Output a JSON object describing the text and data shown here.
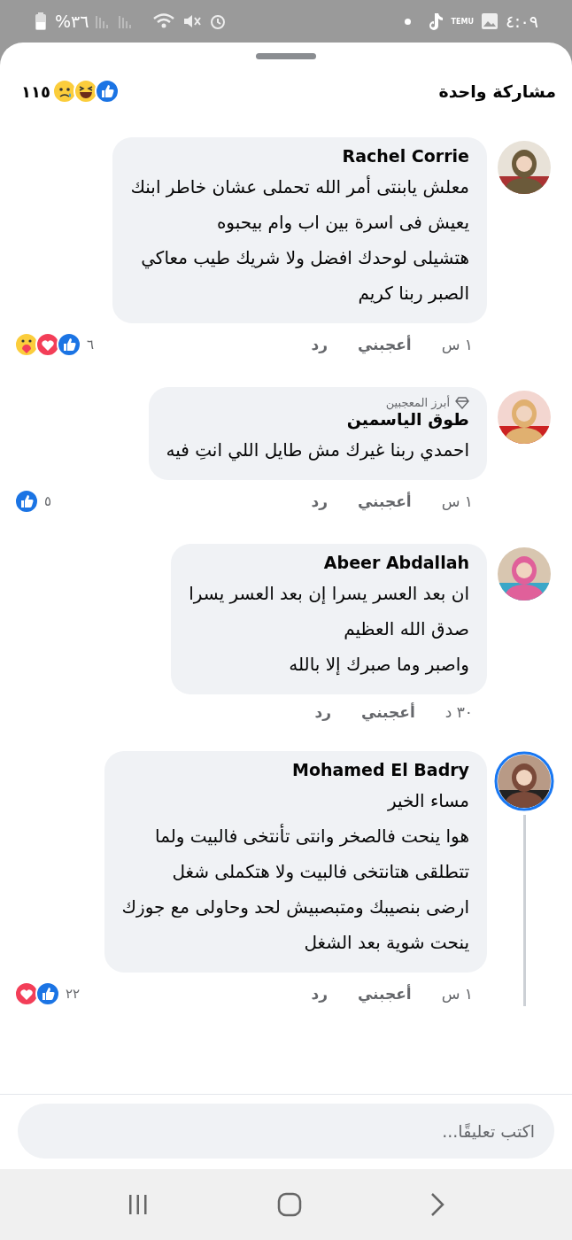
{
  "status_bar": {
    "time": "٤:٠٩",
    "temu_label": "TEMU",
    "battery_text": "%٣٦"
  },
  "header": {
    "title": "مشاركة واحدة",
    "reaction_count": "١١٥",
    "reactions": [
      {
        "kind": "like"
      },
      {
        "kind": "haha"
      },
      {
        "kind": "sad"
      }
    ]
  },
  "comments": [
    {
      "author": "Rachel Corrie",
      "story_ring": false,
      "thread": false,
      "avatar": {
        "kind": "picture"
      },
      "lines": [
        "معلش يابنتى أمر الله تحملى عشان خاطر ابنك",
        "يعيش فى اسرة بين اب وام بيحبوه",
        "هتشيلى لوحدك افضل ولا شريك طيب معاكي",
        "الصبر  ربنا كريم"
      ],
      "time": "١ س",
      "like": "أعجبني",
      "reply": "رد",
      "reaction_count": "٦",
      "reactions": [
        {
          "kind": "like"
        },
        {
          "kind": "love"
        },
        {
          "kind": "care"
        }
      ]
    },
    {
      "author": "طوق الياسمين",
      "badge": "أبرز المعجبين",
      "story_ring": false,
      "thread": false,
      "avatar": {
        "kind": "picture"
      },
      "lines": [
        "احمدي ربنا غيرك مش طايل اللي انتِ فيه"
      ],
      "time": "١ س",
      "like": "أعجبني",
      "reply": "رد",
      "reaction_count": "٥",
      "reactions": [
        {
          "kind": "like"
        }
      ]
    },
    {
      "author": "Abeer Abdallah",
      "story_ring": false,
      "thread": false,
      "avatar": {
        "kind": "picture"
      },
      "lines": [
        "ان بعد العسر يسرا إن بعد العسر يسرا",
        "صدق الله العظيم",
        "واصبر وما صبرك إلا بالله"
      ],
      "time": "٣٠ د",
      "like": "أعجبني",
      "reply": "رد"
    },
    {
      "author": "Mohamed El Badry",
      "story_ring": true,
      "thread": true,
      "avatar": {
        "kind": "picture"
      },
      "lines": [
        "مساء الخير",
        "هوا ينحت فالصخر وانتى تأنتخى فالبيت  ولما",
        "تتطلقى هتانتخى فالبيت ولا هتكملى شغل",
        "ارضى بنصيبك ومتبصبيش لحد وحاولى مع جوزك",
        "ينحت شوية بعد الشغل"
      ],
      "time": "١ س",
      "like": "أعجبني",
      "reply": "رد",
      "reaction_count": "٢٢",
      "reactions": [
        {
          "kind": "like"
        },
        {
          "kind": "love"
        }
      ]
    }
  ],
  "composer": {
    "placeholder": "اكتب تعليقًا..."
  }
}
